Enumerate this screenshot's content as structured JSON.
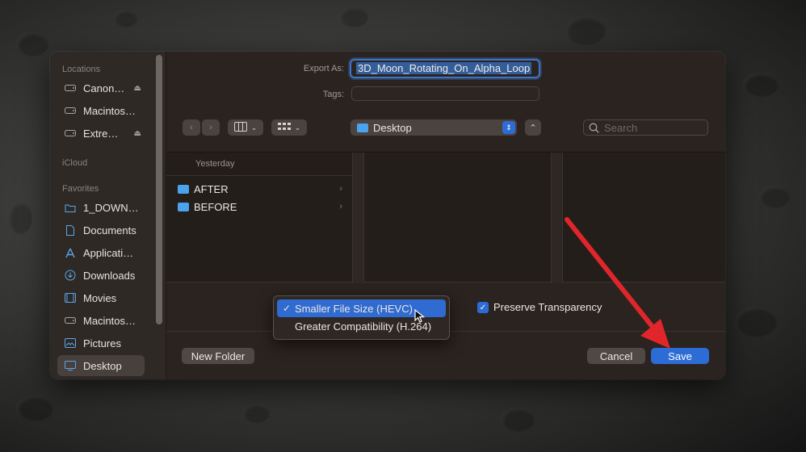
{
  "sidebar": {
    "sections": [
      {
        "label": "Locations"
      },
      {
        "label": "iCloud"
      },
      {
        "label": "Favorites"
      }
    ],
    "items": [
      {
        "label": "Canon…",
        "icon": "drive-icon"
      },
      {
        "label": "Macintos…",
        "icon": "drive-icon"
      },
      {
        "label": "Extre…",
        "icon": "drive-icon"
      },
      {
        "label": "1_DOWN…",
        "icon": "folder-icon"
      },
      {
        "label": "Documents",
        "icon": "document-icon"
      },
      {
        "label": "Applicati…",
        "icon": "applications-icon"
      },
      {
        "label": "Downloads",
        "icon": "download-icon"
      },
      {
        "label": "Movies",
        "icon": "film-icon"
      },
      {
        "label": "Macintos…",
        "icon": "drive-icon"
      },
      {
        "label": "Pictures",
        "icon": "picture-icon"
      },
      {
        "label": "Desktop",
        "icon": "desktop-icon"
      }
    ]
  },
  "form": {
    "export_as_label": "Export As:",
    "export_as_value": "3D_Moon_Rotating_On_Alpha_Loop",
    "tags_label": "Tags:",
    "location_value": "Desktop",
    "search_placeholder": "Search"
  },
  "browser": {
    "group_header": "Yesterday",
    "items": [
      {
        "label": "AFTER"
      },
      {
        "label": "BEFORE"
      }
    ]
  },
  "options": {
    "format_menu": [
      {
        "label": "Smaller File Size (HEVC)",
        "selected": true
      },
      {
        "label": "Greater Compatibility (H.264)",
        "selected": false
      }
    ],
    "preserve_transparency_label": "Preserve Transparency",
    "preserve_transparency_checked": true
  },
  "footer": {
    "new_folder_label": "New Folder",
    "cancel_label": "Cancel",
    "save_label": "Save"
  },
  "colors": {
    "accent": "#2d6cd4",
    "folder": "#4aa3ec",
    "annotation_arrow": "#e0262a"
  }
}
